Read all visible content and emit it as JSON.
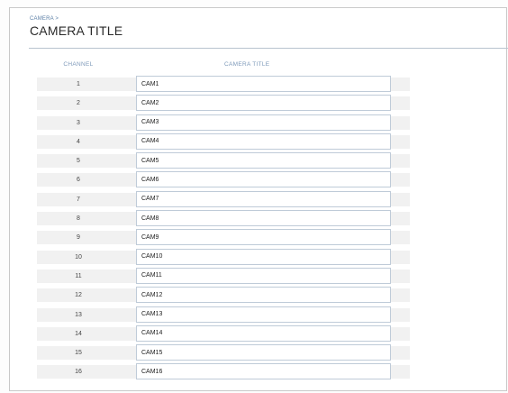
{
  "header": {
    "breadcrumb": "CAMERA >",
    "title": "CAMERA TITLE"
  },
  "table": {
    "columns": [
      "CHANNEL",
      "CAMERA TITLE"
    ],
    "rows": [
      {
        "channel": "1",
        "title": "CAM1"
      },
      {
        "channel": "2",
        "title": "CAM2"
      },
      {
        "channel": "3",
        "title": "CAM3"
      },
      {
        "channel": "4",
        "title": "CAM4"
      },
      {
        "channel": "5",
        "title": "CAM5"
      },
      {
        "channel": "6",
        "title": "CAM6"
      },
      {
        "channel": "7",
        "title": "CAM7"
      },
      {
        "channel": "8",
        "title": "CAM8"
      },
      {
        "channel": "9",
        "title": "CAM9"
      },
      {
        "channel": "10",
        "title": "CAM10"
      },
      {
        "channel": "11",
        "title": "CAM11"
      },
      {
        "channel": "12",
        "title": "CAM12"
      },
      {
        "channel": "13",
        "title": "CAM13"
      },
      {
        "channel": "14",
        "title": "CAM14"
      },
      {
        "channel": "15",
        "title": "CAM15"
      },
      {
        "channel": "16",
        "title": "CAM16"
      }
    ]
  },
  "colors": {
    "header_text": "#7d99b9",
    "row_band": "#f1f1f1",
    "input_border": "#bfcbd8"
  }
}
